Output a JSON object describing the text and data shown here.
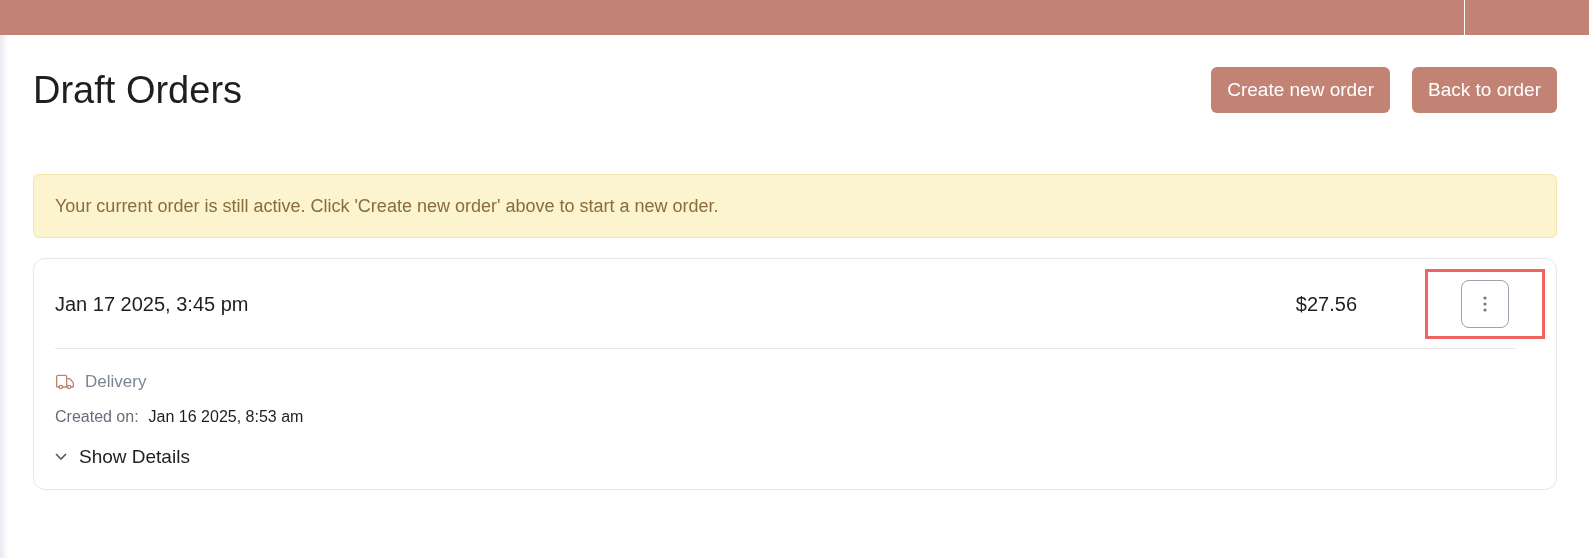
{
  "page": {
    "title": "Draft Orders"
  },
  "actions": [
    {
      "label": "Create new order"
    },
    {
      "label": "Back to order"
    }
  ],
  "alert": {
    "text": "Your current order is still active. Click 'Create new order' above to start a new order."
  },
  "orders": [
    {
      "date": "Jan 17 2025, 3:45 pm",
      "total": "$27.56",
      "highlighted": true,
      "method": "Delivery",
      "created_label": "Created on:",
      "created": "Jan 16 2025, 8:53 am",
      "details_toggle": "Show Details",
      "expanded": false
    }
  ]
}
